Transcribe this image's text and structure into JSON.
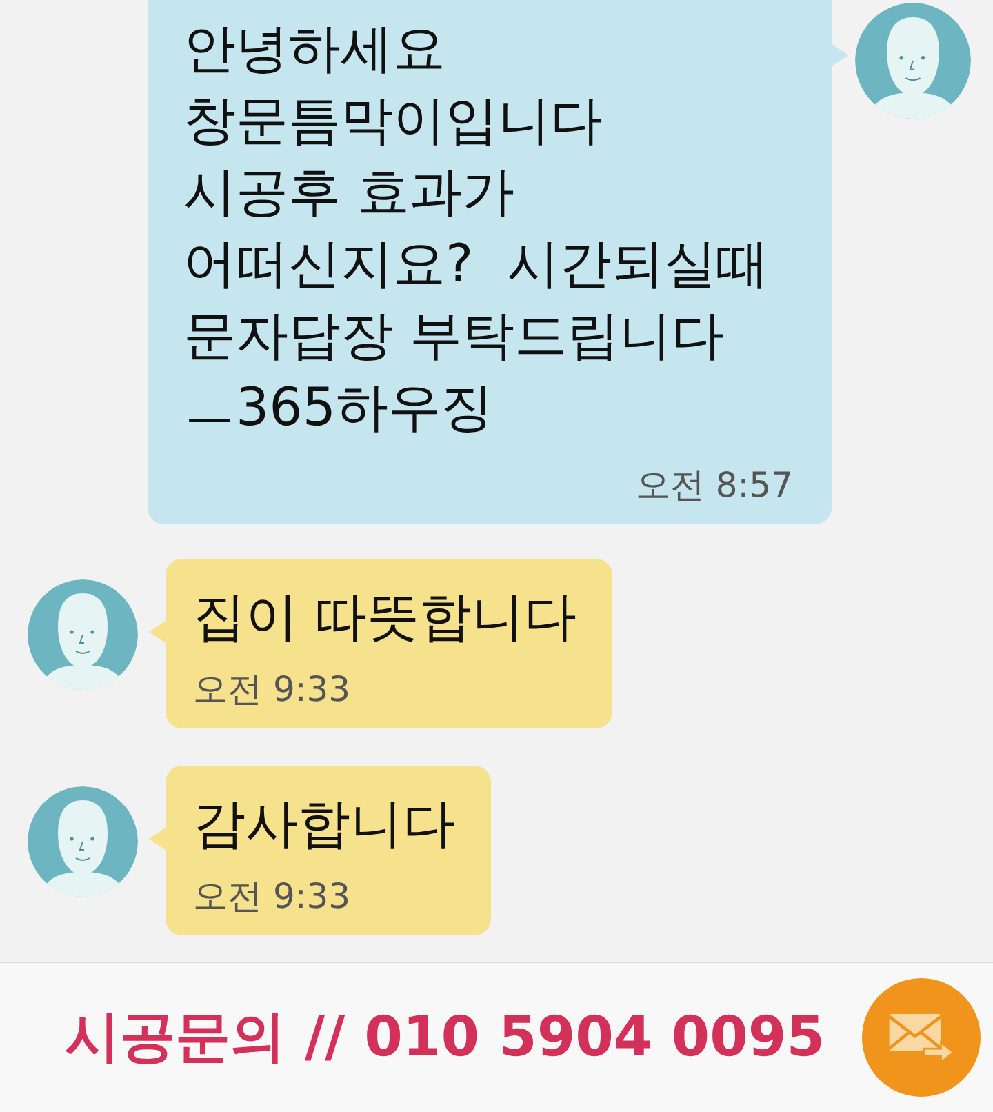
{
  "messages": [
    {
      "kind": "outgoing",
      "text": "안녕하세요\n창문틈막이입니다\n시공후 효과가\n어떠신지요?  시간되실때\n문자답장 부탁드립니다\nㅡ365하우징",
      "time": "오전 8:57"
    },
    {
      "kind": "incoming",
      "text": "집이 따뜻합니다",
      "time": "오전 9:33"
    },
    {
      "kind": "incoming",
      "text": "감사합니다",
      "time": "오전 9:33"
    }
  ],
  "input_bar": {
    "value": "시공문의 // 010 5904 0095"
  }
}
